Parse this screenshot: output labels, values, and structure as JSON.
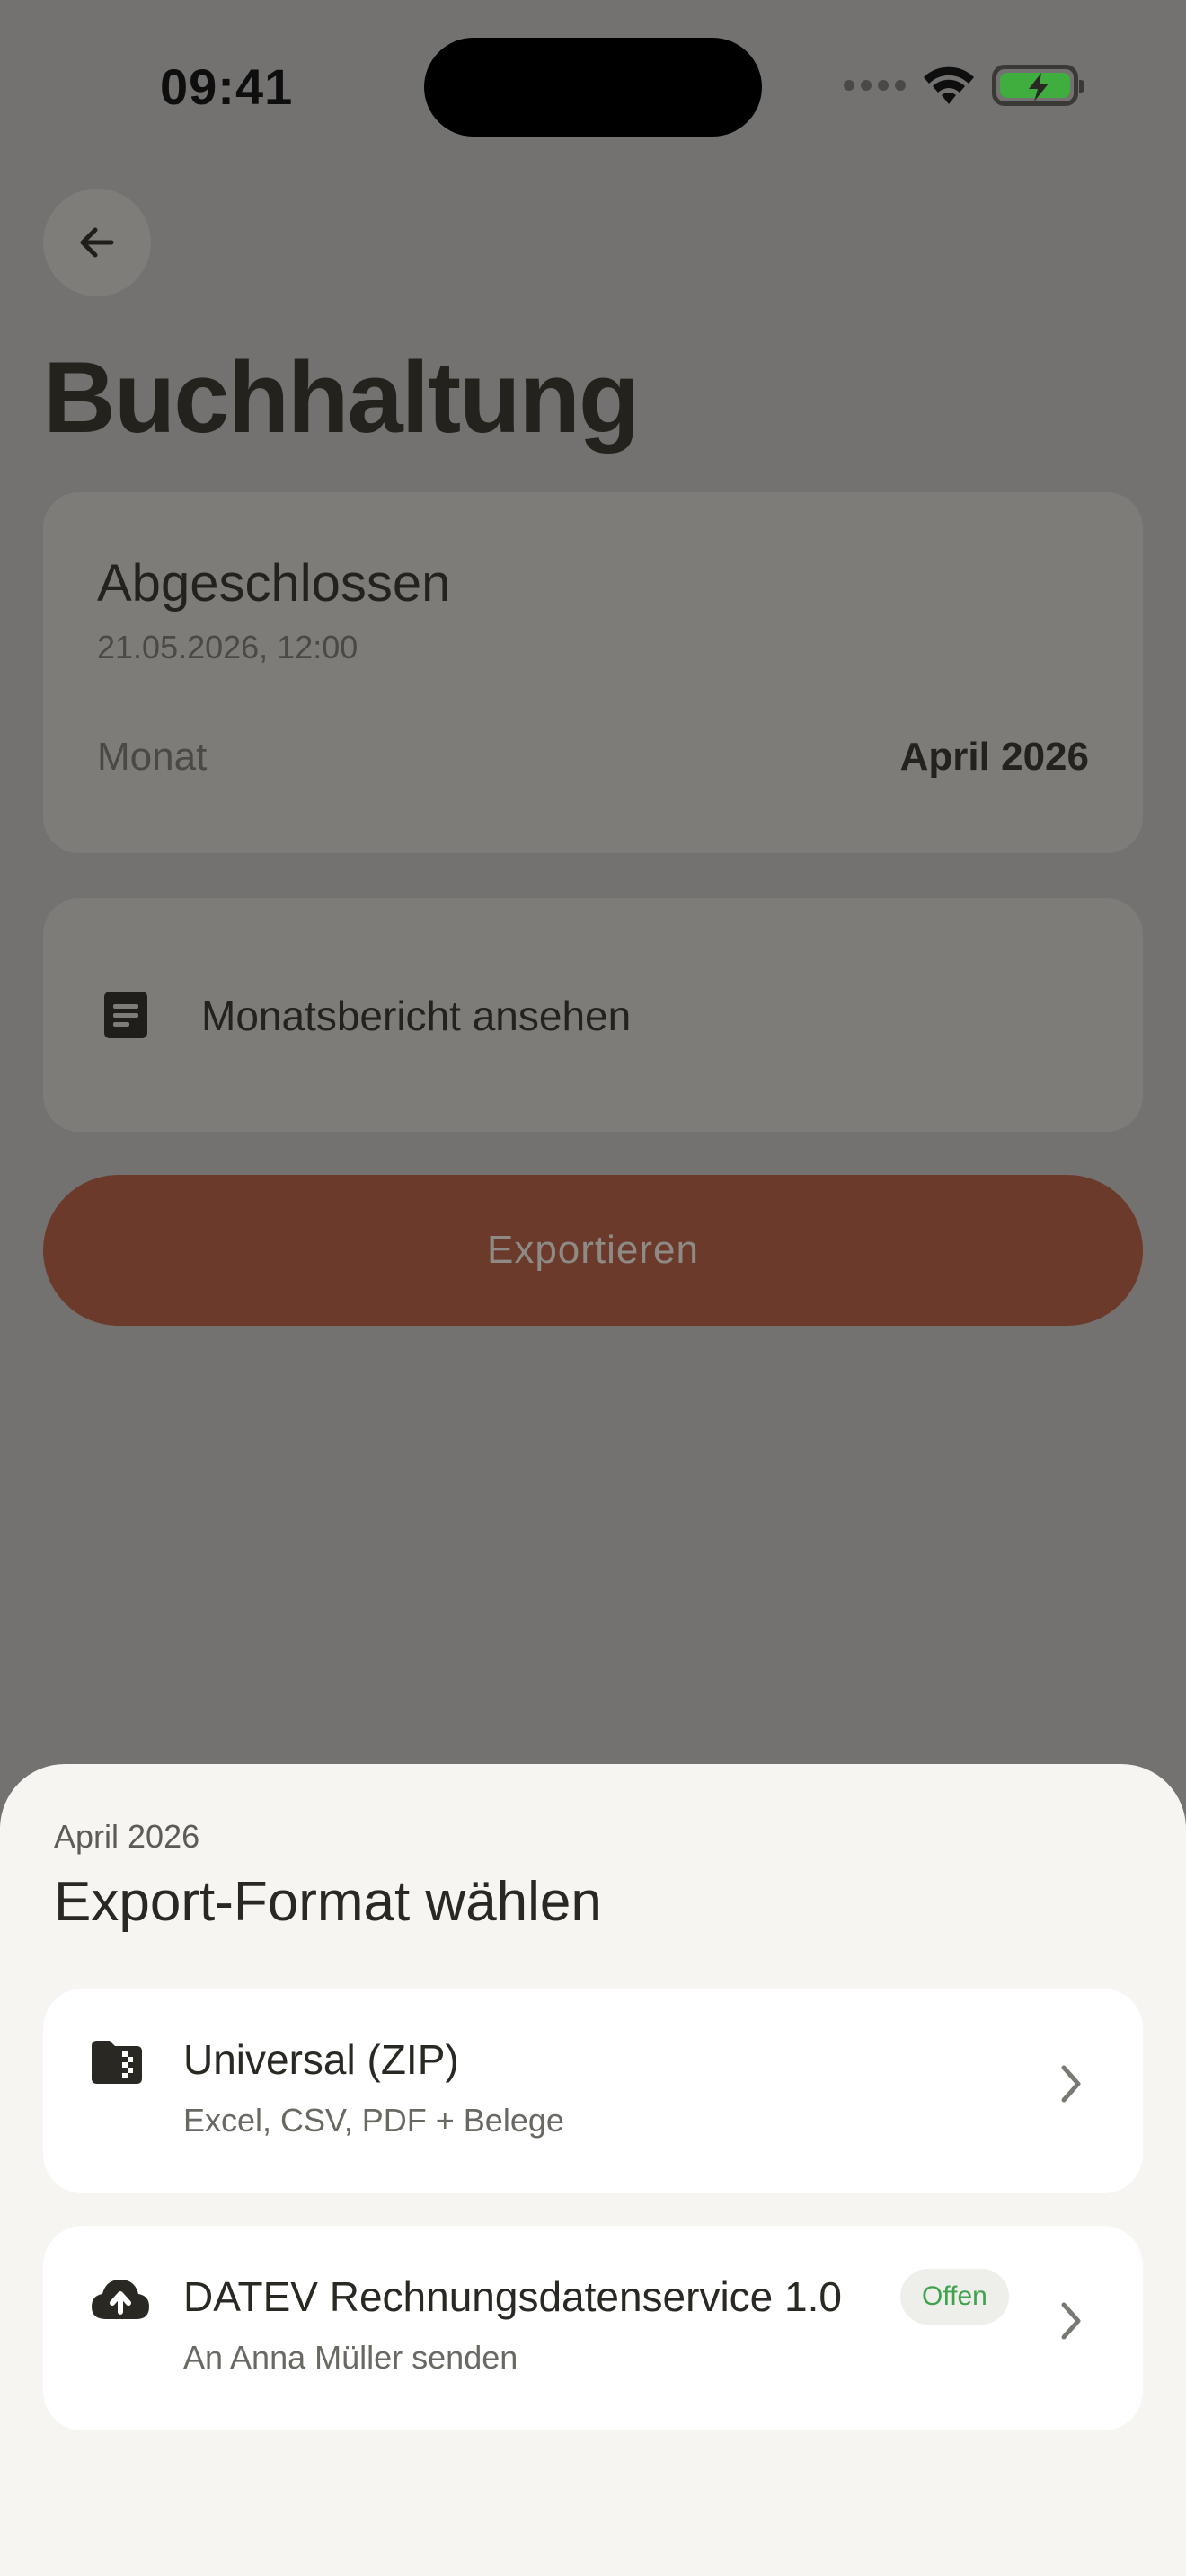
{
  "status_bar": {
    "time": "09:41"
  },
  "header": {
    "title": "Buchhaltung"
  },
  "status_card": {
    "state": "Abgeschlossen",
    "timestamp": "21.05.2026, 12:00",
    "month_label": "Monat",
    "month_value": "April 2026"
  },
  "report_card": {
    "label": "Monatsbericht ansehen",
    "icon": "document-icon"
  },
  "export_button": {
    "label": "Exportieren",
    "color": "#6b3a2b"
  },
  "sheet": {
    "eyebrow": "April 2026",
    "title": "Export-Format wählen",
    "options": [
      {
        "title": "Universal (ZIP)",
        "subtitle": "Excel, CSV, PDF + Belege",
        "icon": "zip-folder-icon"
      },
      {
        "title": "DATEV Rechnungsdatenservice 1.0",
        "subtitle": "An Anna Müller senden",
        "badge": "Offen",
        "icon": "cloud-upload-icon"
      }
    ]
  },
  "colors": {
    "accent_green": "#3fa34d",
    "battery_green": "#3fae3f"
  }
}
